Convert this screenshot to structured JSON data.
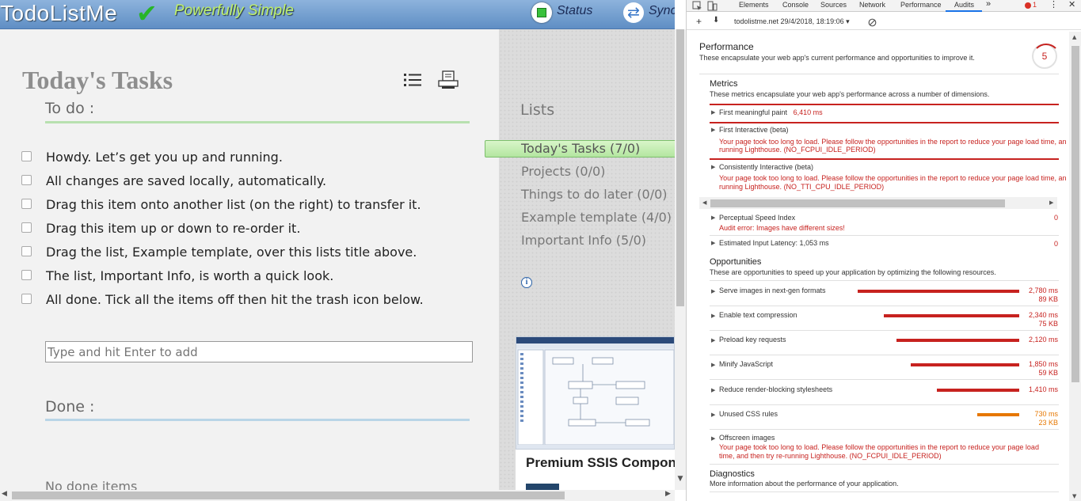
{
  "app": {
    "logo": "TodoListMe",
    "tagline": "Powerfully Simple",
    "status_label": "Status",
    "sync_label": "Sync",
    "page_title": "Today's Tasks",
    "todo_heading": "To do :",
    "tasks": [
      "Howdy. Let’s get you up and running.",
      "All changes are saved locally, automatically.",
      "Drag this item onto another list (on the right) to transfer it.",
      "Drag this item up or down to re-order it.",
      "Drag the list, Example template, over this lists title above.",
      "The list, Important Info, is worth a quick look.",
      "All done. Tick all the items off then hit the trash icon below."
    ],
    "add_placeholder": "Type and hit Enter to add",
    "done_heading": "Done :",
    "no_done": "No done items",
    "lists_heading": "Lists",
    "lists": [
      "Today's Tasks (7/0)",
      "Projects (0/0)",
      "Things to do later (0/0)",
      "Example template (4/0)",
      "Important Info (5/0)"
    ],
    "ad_title": "Premium SSIS Compon"
  },
  "devtools": {
    "tabs": [
      "Elements",
      "Console",
      "Sources",
      "Network",
      "Performance",
      "Audits"
    ],
    "active_tab": "Audits",
    "more_tabs": "»",
    "error_count": "1",
    "report_url": "todolistme.net 29/4/2018, 18:19:06",
    "performance": {
      "title": "Performance",
      "desc": "These encapsulate your web app's current performance and opportunities to improve it.",
      "score": "5"
    },
    "metrics": {
      "title": "Metrics",
      "desc": "These metrics encapsulate your web app's performance across a number of dimensions.",
      "fmp_label": "First meaningful paint",
      "fmp_value": "6,410 ms",
      "fi_label": "First Interactive (beta)",
      "fi_err_1": "Your page took too long to load. Please follow the opportunities in the report to reduce your page load time, an",
      "fi_err_2": "running Lighthouse. (NO_FCPUI_IDLE_PERIOD)",
      "ci_label": "Consistently Interactive (beta)",
      "ci_err_1": "Your page took too long to load. Please follow the opportunities in the report to reduce your page load time, an",
      "ci_err_2": "running Lighthouse. (NO_TTI_CPU_IDLE_PERIOD)",
      "psi_label": "Perceptual Speed Index",
      "psi_err": "Audit error: Images have different sizes!",
      "psi_score": "0",
      "eil_label": "Estimated Input Latency: 1,053 ms",
      "eil_score": "0"
    },
    "opportunities": {
      "title": "Opportunities",
      "desc": "These are opportunities to speed up your application by optimizing the following resources.",
      "items": [
        {
          "label": "Serve images in next-gen formats",
          "ms": "2,780 ms",
          "kb": "89 KB",
          "fraction": 1.0
        },
        {
          "label": "Enable text compression",
          "ms": "2,340 ms",
          "kb": "75 KB",
          "fraction": 0.84
        },
        {
          "label": "Preload key requests",
          "ms": "2,120 ms",
          "kb": "",
          "fraction": 0.76
        },
        {
          "label": "Minify JavaScript",
          "ms": "1,850 ms",
          "kb": "59 KB",
          "fraction": 0.67
        },
        {
          "label": "Reduce render-blocking stylesheets",
          "ms": "1,410 ms",
          "kb": "",
          "fraction": 0.51
        },
        {
          "label": "Unused CSS rules",
          "ms": "730 ms",
          "kb": "23 KB",
          "fraction": 0.26
        }
      ],
      "offscreen_label": "Offscreen images",
      "offscreen_err_1": "Your page took too long to load. Please follow the opportunities in the report to reduce your page load",
      "offscreen_err_2": "time, and then try re-running Lighthouse. (NO_FCPUI_IDLE_PERIOD)"
    },
    "diagnostics": {
      "title": "Diagnostics",
      "desc": "More information about the performance of your application."
    },
    "colors": {
      "fail": "#c7221f",
      "average": "#e67700",
      "accent": "#1a73e8"
    }
  }
}
